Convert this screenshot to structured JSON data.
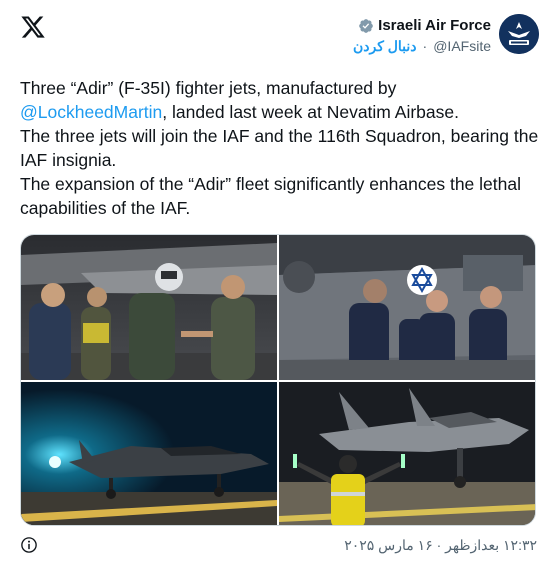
{
  "header": {
    "display_name": "Israeli Air Force",
    "follow_label": "دنبال کردن",
    "separator": "·",
    "handle": "@IAFsite"
  },
  "tweet": {
    "line1_before": "Three “Adir” (F-35I) fighter jets, manufactured by",
    "mention": "@LockheedMartin",
    "line2_after": ", landed last week at Nevatim Airbase.",
    "line3": "The three jets will join the IAF and the 116th Squadron, bearing the IAF insignia.",
    "line4": "The expansion of the “Adir” fleet significantly enhances the lethal capabilities of the IAF."
  },
  "footer": {
    "timestamp": "۱۲:۳۲ بعدازظهر · ۱۶ مارس ۲۰۲۵"
  },
  "icons": {
    "x_logo": "x-logo-icon",
    "verified": "verified-badge-icon",
    "info": "info-icon"
  },
  "colors": {
    "link": "#1d9bf0",
    "verified_badge": "#829aab",
    "text": "#0f1419",
    "muted": "#536471"
  }
}
